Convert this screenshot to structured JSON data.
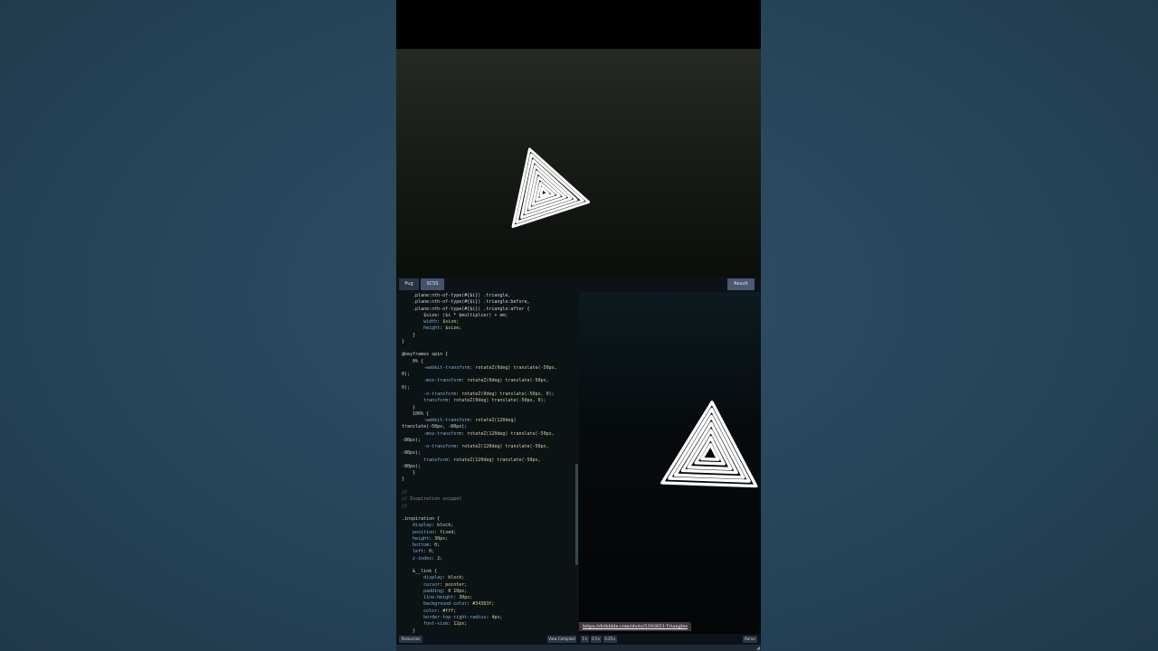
{
  "toolbar": {
    "tab_pug": "Pug",
    "tab_scss": "SCSS",
    "result": "Result"
  },
  "editor": {
    "lines": [
      "    .plane:nth-of-type(#{$i}) .triangle,",
      "    .plane:nth-of-type(#{$i}) .triangle:before,",
      "    .plane:nth-of-type(#{$i}) .triangle:after {",
      "        $size: ($i * $multiplier) + em;",
      "        width: $size;",
      "        height: $size;",
      "    }",
      "}",
      "",
      "@keyframes spin {",
      "    0% {",
      "        -webkit-transform: rotateZ(0deg) translate(-50px,",
      "0);",
      "        -moz-transform: rotateZ(0deg) translate(-50px,",
      "0);",
      "        -o-transform: rotateZ(0deg) translate(-50px, 0);",
      "        transform: rotateZ(0deg) translate(-50px, 0);",
      "    }",
      "    100% {",
      "        -webkit-transform: rotateZ(120deg)",
      "translate(-50px, -80px);",
      "        -moz-transform: rotateZ(120deg) translate(-50px,",
      "-80px);",
      "        -o-transform: rotateZ(120deg) translate(-50px,",
      "-80px);",
      "        transform: rotateZ(120deg) translate(-50px,",
      "-80px);",
      "    }",
      "}",
      "",
      "//",
      "// Inspiration snippet",
      "//",
      "",
      ".inspiration {",
      "    display: block;",
      "    position: fixed;",
      "    height: 30px;",
      "    bottom: 0;",
      "    left: 0;",
      "    z-index: 2;",
      "",
      "    &__link {",
      "        display: block;",
      "        cursor: pointer;",
      "        padding: 0 10px;",
      "        line-height: 30px;",
      "        background-color: #34363f;",
      "        color: #fff;",
      "        border-top-right-radius: 4px;",
      "        font-size: 12px;",
      "    }",
      "}"
    ]
  },
  "result": {
    "link_text": "https://dribbble.com/shots/5392653-Triangles"
  },
  "bottombar": {
    "resources": "Resources",
    "view_compiled": "View Compiled",
    "zoom_1x": "1×",
    "zoom_05x": "0.5×",
    "zoom_025x": "0.25×",
    "rerun": "Rerun"
  },
  "colors": {
    "page_background": "#274459",
    "active_tab": "#43536a",
    "link_background": "#43363f",
    "triangle_stripe": "#ffffff"
  },
  "icons": {
    "resize": "resize-grip-icon"
  }
}
